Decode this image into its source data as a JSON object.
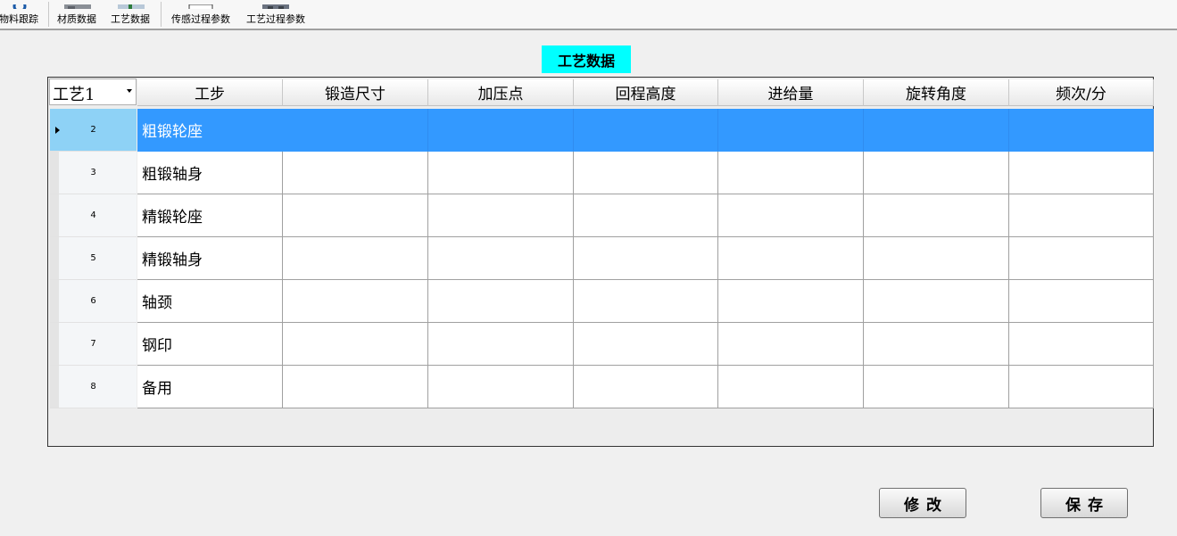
{
  "toolbar": {
    "items": [
      {
        "label": "物料跟踪",
        "icon": "gear-icon"
      },
      {
        "label": "材质数据",
        "icon": "material-data-icon"
      },
      {
        "label": "工艺数据",
        "icon": "process-data-icon"
      },
      {
        "label": "传感过程参数",
        "icon": "sensor-params-icon"
      },
      {
        "label": "工艺过程参数",
        "icon": "process-params-icon"
      }
    ]
  },
  "title": "工艺数据",
  "grid": {
    "process_select": "工艺1",
    "columns": [
      "工步",
      "锻造尺寸",
      "加压点",
      "回程高度",
      "进给量",
      "旋转角度",
      "频次/分"
    ],
    "rows": [
      {
        "num": "2",
        "step": "粗锻轮座",
        "selected": true
      },
      {
        "num": "3",
        "step": "粗锻轴身"
      },
      {
        "num": "4",
        "step": "精锻轮座"
      },
      {
        "num": "5",
        "step": "精锻轴身"
      },
      {
        "num": "6",
        "step": "轴颈"
      },
      {
        "num": "7",
        "step": "钢印"
      },
      {
        "num": "8",
        "step": "备用"
      }
    ],
    "selection_color": "#3399ff"
  },
  "buttons": {
    "modify": "修改",
    "save": "保存"
  },
  "colors": {
    "title_bg": "#00ffff"
  }
}
